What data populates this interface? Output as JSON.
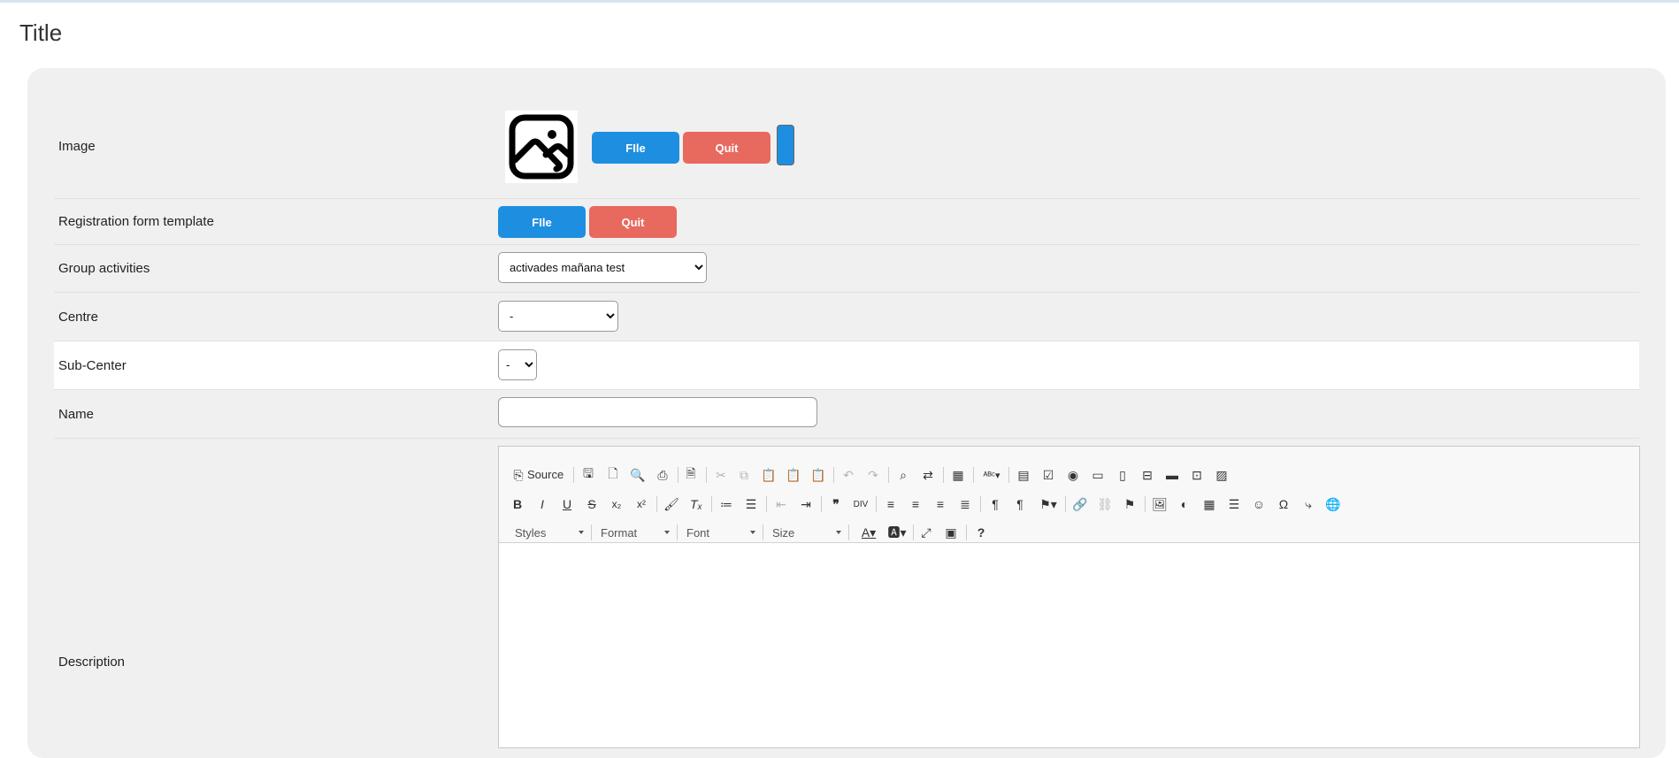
{
  "page": {
    "title": "Title"
  },
  "form": {
    "image": {
      "label": "Image",
      "file_label": "FIle",
      "quit_label": "Quit"
    },
    "registration": {
      "label": "Registration form template",
      "file_label": "FIle",
      "quit_label": "Quit"
    },
    "group_activities": {
      "label": "Group activities",
      "selected": "activades mañana test"
    },
    "centre": {
      "label": "Centre",
      "selected": "-"
    },
    "sub_center": {
      "label": "Sub-Center",
      "selected": "-"
    },
    "name": {
      "label": "Name",
      "value": ""
    },
    "description": {
      "label": "Description"
    }
  },
  "editor": {
    "source_label": "Source",
    "styles_label": "Styles",
    "format_label": "Format",
    "font_label": "Font",
    "size_label": "Size"
  },
  "colors": {
    "accent_blue": "#1e8fe0",
    "quit_red": "#e8695e",
    "panel_bg": "#f0f0f0"
  }
}
